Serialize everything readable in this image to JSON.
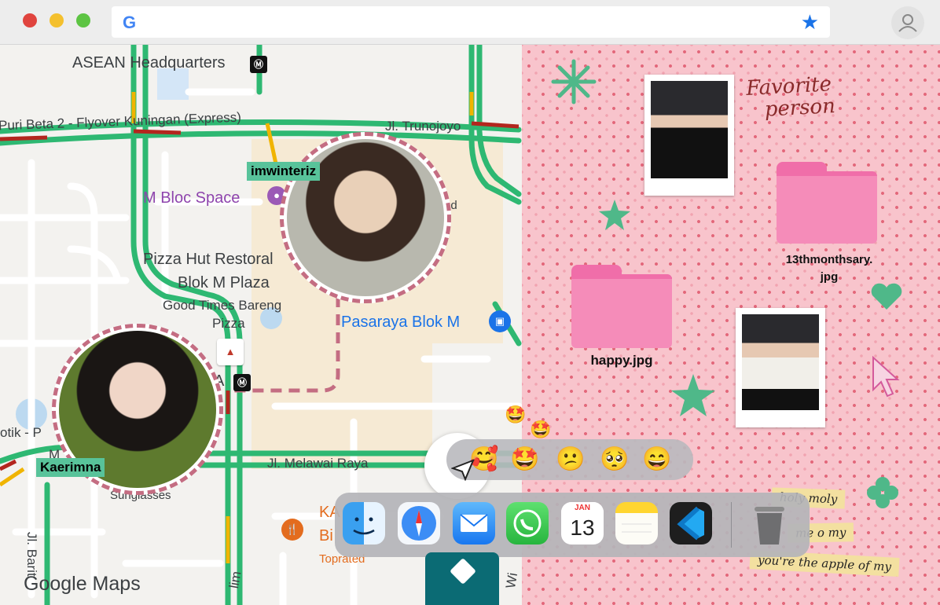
{
  "browser": {
    "search_logo": "G",
    "bookmark_icon": "star-icon",
    "profile_icon": "person-icon",
    "traffic_lights": [
      "#e0443e",
      "#f4c02e",
      "#5dc443"
    ]
  },
  "map": {
    "labels": {
      "asean": "ASEAN Headquarters",
      "flyover": "Puri Beta 2 - Flyover Kuningan (Express)",
      "trunojoyo": "Jl. Trunojoyo",
      "mbloc": "M Bloc Space",
      "pizza": "Pizza Hut Restoral",
      "blokm": "Blok M Plaza",
      "goodtimes": "Good Times Bareng",
      "pizza2": "Pizza",
      "pasaraya": "Pasaraya Blok M",
      "melawai": "Jl. Melawai Raya",
      "otik": "otik - P",
      "m": "M",
      "sunglasses": "Sunglasses",
      "ka": "KA",
      "bi": "Bi",
      "topra": "Toprated",
      "jlbarit": "Jl. Barit",
      "lim": "lim",
      "ed": "ed",
      "wi": "Wi",
      "a": "A"
    },
    "people": [
      {
        "name": "imwinteriz"
      },
      {
        "name": "Kaerimna"
      }
    ],
    "brand": "Google Maps",
    "colors": {
      "road_major": "#2eb872",
      "road_minor": "#ffffff",
      "route": "#c46d82"
    }
  },
  "desktop": {
    "handwriting": [
      "Favorite",
      "person"
    ],
    "files": [
      {
        "label_line1": "13thmonthsary.",
        "label_line2": "jpg"
      },
      {
        "label_line1": "happy.jpg",
        "label_line2": ""
      }
    ],
    "stickies": [
      "holy moly",
      "me o my",
      "you're the apple of my"
    ],
    "colors": {
      "background": "#f8c4cc",
      "dots": "#e3677a",
      "folder": "#f58cb9",
      "accent_green": "#4fb889"
    }
  },
  "reactions": {
    "emojis": [
      "🥰",
      "🤩",
      "😕",
      "🥺",
      "😄"
    ],
    "floating": [
      "🤩",
      "🤩"
    ]
  },
  "dock": {
    "apps": [
      "Finder",
      "Safari",
      "Mail",
      "WhatsApp",
      "Calendar",
      "Notes",
      "Visual Studio Code",
      "Trash"
    ],
    "calendar_month": "JAN",
    "calendar_day": "13"
  }
}
